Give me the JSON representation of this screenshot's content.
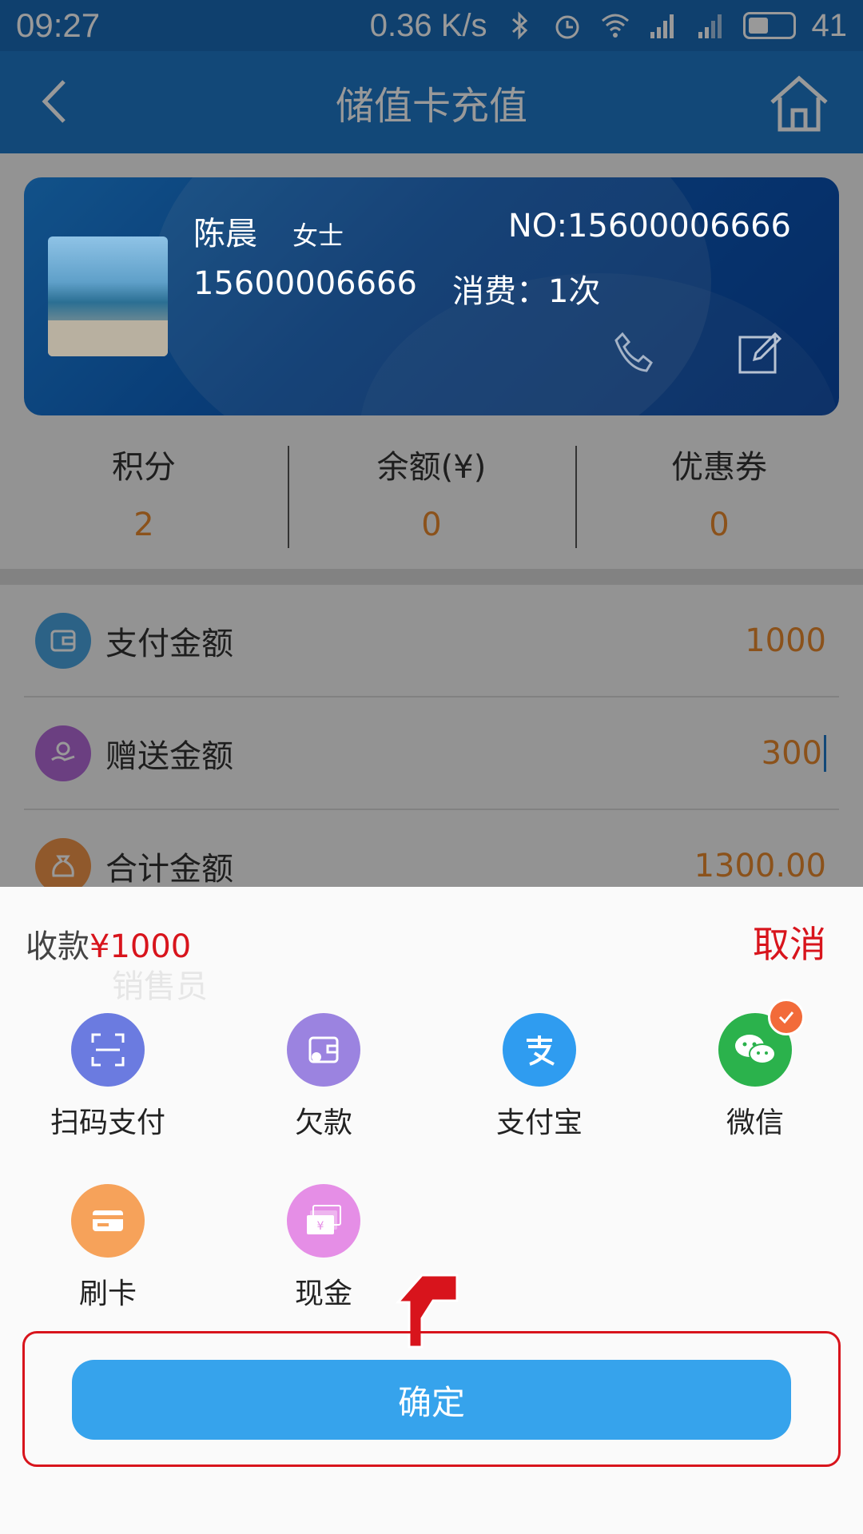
{
  "status_bar": {
    "time": "09:27",
    "speed": "0.36 K/s",
    "battery": "41"
  },
  "header": {
    "title": "储值卡充值"
  },
  "card": {
    "name": "陈晨",
    "title": "女士",
    "number": "NO:15600006666",
    "phone": "15600006666",
    "consume": "消费：1次"
  },
  "stats": [
    {
      "label": "积分",
      "value": "2"
    },
    {
      "label": "余额(¥)",
      "value": "0"
    },
    {
      "label": "优惠券",
      "value": "0"
    }
  ],
  "rows": [
    {
      "label": "支付金额",
      "value": "1000",
      "icon": "wallet-icon",
      "color": "#4aa3df"
    },
    {
      "label": "赠送金额",
      "value": "300",
      "icon": "gift-hand-icon",
      "color": "#b36ad8"
    },
    {
      "label": "合计金额",
      "value": "1300.00",
      "icon": "money-bag-icon",
      "color": "#f0944a"
    }
  ],
  "sheet": {
    "title_prefix": "收款",
    "amount": "¥1000",
    "cancel": "取消",
    "background_hint": "销售员",
    "confirm": "确定",
    "methods": [
      {
        "label": "扫码支付",
        "icon": "scan-icon",
        "color": "#6b7be0",
        "selected": false
      },
      {
        "label": "欠款",
        "icon": "debt-wallet-icon",
        "color": "#9b83e0",
        "selected": false
      },
      {
        "label": "支付宝",
        "icon": "alipay-icon",
        "color": "#2f9cf0",
        "selected": false
      },
      {
        "label": "微信",
        "icon": "wechat-icon",
        "color": "#2bb24c",
        "selected": true
      },
      {
        "label": "刷卡",
        "icon": "card-swipe-icon",
        "color": "#f6a25a",
        "selected": false
      },
      {
        "label": "现金",
        "icon": "cash-icon",
        "color": "#e58ee6",
        "selected": false
      }
    ]
  },
  "colors": {
    "accent": "#1f78c9",
    "orange_value": "#e8892e",
    "danger": "#d8141c",
    "confirm": "#36a3ec"
  }
}
